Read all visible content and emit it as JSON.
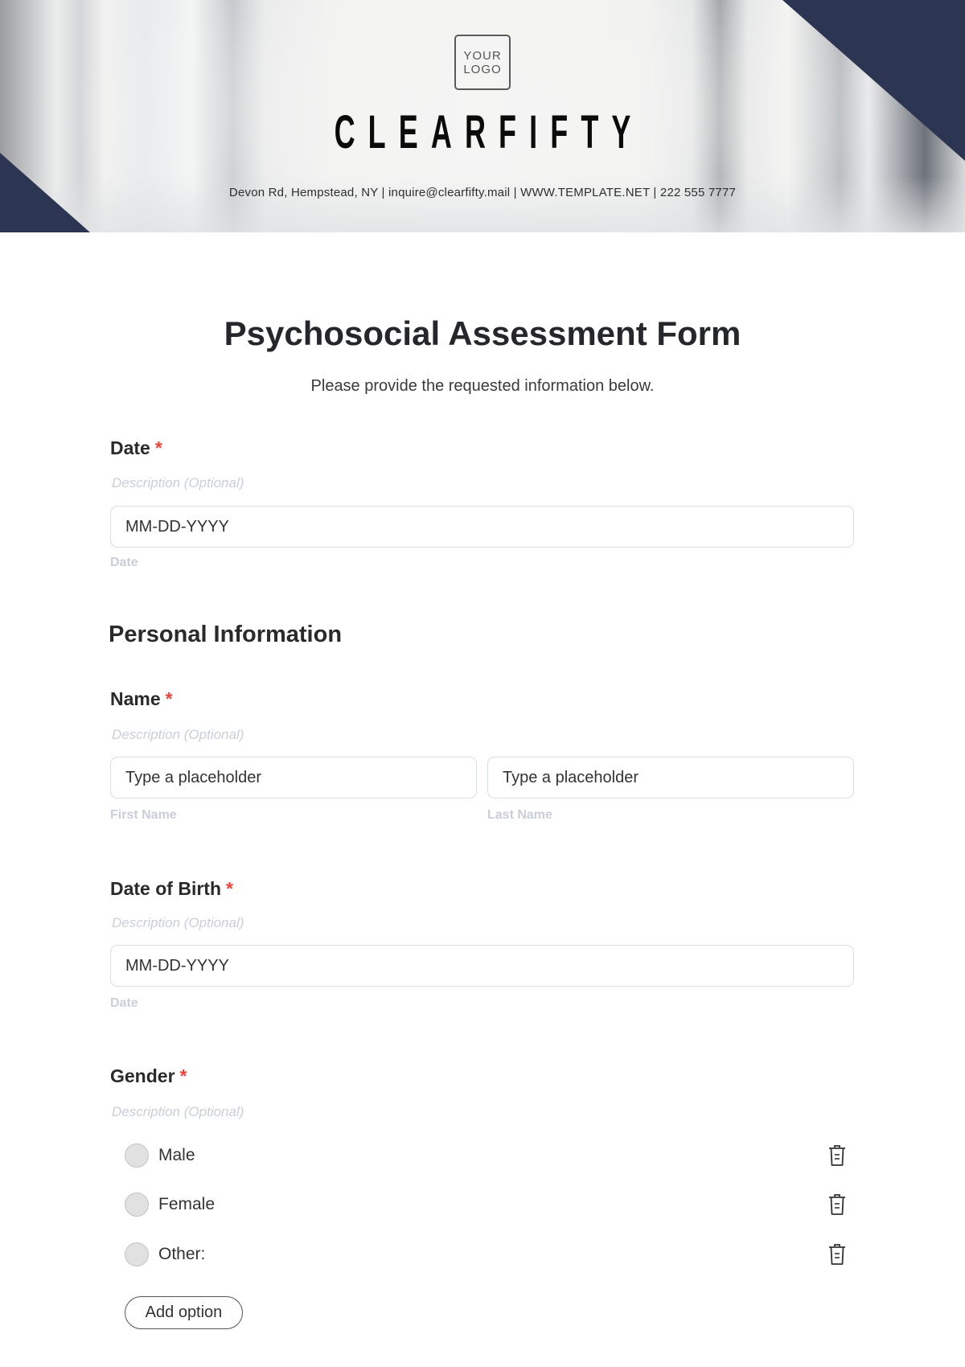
{
  "header": {
    "logo_text": "YOUR\nLOGO",
    "brand_name": "CLEARFIFTY",
    "contact_line": "Devon Rd, Hempstead, NY | inquire@clearfifty.mail | WWW.TEMPLATE.NET | 222 555 7777",
    "accent_color": "#2c3652"
  },
  "form": {
    "title": "Psychosocial Assessment Form",
    "subtitle": "Please provide the requested information below.",
    "required_marker": "*",
    "fields": {
      "date": {
        "label": "Date",
        "description": "Description (Optional)",
        "value": "MM-DD-YYYY",
        "sublabel": "Date"
      },
      "name": {
        "label": "Name",
        "description": "Description (Optional)",
        "first_placeholder": "Type a placeholder",
        "last_placeholder": "Type a placeholder",
        "first_sublabel": "First Name",
        "last_sublabel": "Last Name"
      },
      "dob": {
        "label": "Date of Birth",
        "description": "Description (Optional)",
        "value": "MM-DD-YYYY",
        "sublabel": "Date"
      },
      "gender": {
        "label": "Gender",
        "description": "Description (Optional)",
        "options": [
          {
            "label": "Male",
            "selected": false
          },
          {
            "label": "Female",
            "selected": false
          },
          {
            "label": "Other:",
            "selected": false
          }
        ],
        "add_option_label": "Add option"
      }
    },
    "sections": {
      "personal_information": "Personal Information"
    }
  }
}
